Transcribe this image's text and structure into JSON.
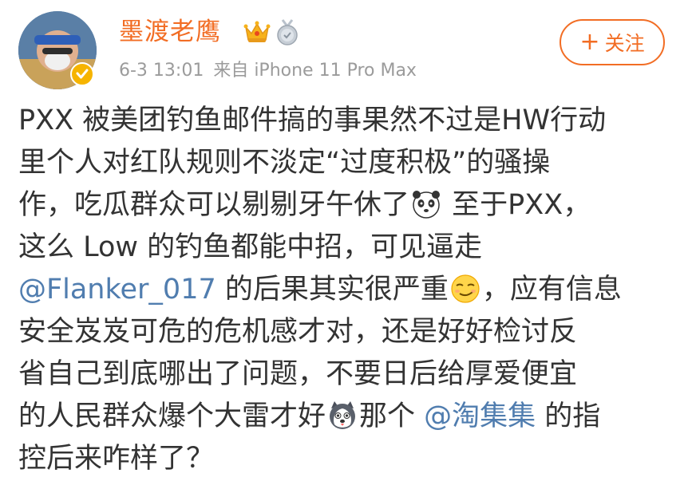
{
  "author": {
    "name": "墨渡老鹰",
    "badge_icon": "crown-icon",
    "medal_icon": "medal-icon",
    "verified_icon": "verified-badge-icon",
    "time": "6-3 13:01",
    "source": "来自 iPhone 11 Pro Max"
  },
  "follow": {
    "plus": "+",
    "label": "关注"
  },
  "post": {
    "line1": "PXX 被美团钓鱼邮件搞的事果然不过是HW行动",
    "line2": "里个人对红队规则不淡定“过度积极”的骚操",
    "line3a": "作，吃瓜群众可以剔剔牙午休了",
    "line3b": " 至于PXX，",
    "line4": "这么 Low 的钓鱼都能中招，可见逼走",
    "mention1": "@Flanker_017",
    "line5a": " 的后果其实很严重",
    "line5b": "，应有信息",
    "line6": "安全岌岌可危的危机感才对，还是好好检讨反",
    "line7": "省自己到底哪出了问题，不要日后给厚爱便宜",
    "line8a": "的人民群众爆个大雷才好",
    "line8b": "那个 ",
    "mention2": "@淘集集",
    "line8c": " 的指",
    "line9": "控后来咋样了？",
    "emoji1": "panda-emoji",
    "emoji2": "smirk-emoji",
    "emoji3": "husky-emoji"
  },
  "colors": {
    "accent": "#f26d24",
    "link": "#507daf",
    "text": "#333333",
    "meta": "#9b9b9b"
  }
}
